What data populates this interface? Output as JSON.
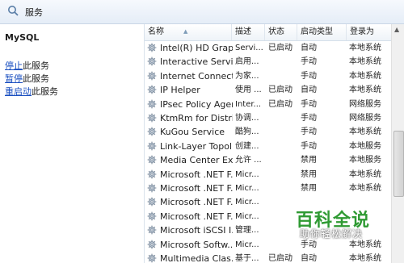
{
  "window": {
    "title": "服务"
  },
  "left_pane": {
    "service_name": "MySQL",
    "actions": [
      {
        "link": "停止",
        "suffix": "此服务"
      },
      {
        "link": "暂停",
        "suffix": "此服务"
      },
      {
        "link": "重启动",
        "suffix": "此服务"
      }
    ]
  },
  "table": {
    "columns": [
      "名称",
      "描述",
      "状态",
      "启动类型",
      "登录为"
    ],
    "sort_column": "名称",
    "rows": [
      {
        "name": "Intel(R) HD Grap...",
        "desc": "Servi...",
        "state": "已启动",
        "startup": "自动",
        "logon": "本地系统"
      },
      {
        "name": "Interactive Servi...",
        "desc": "启用...",
        "state": "",
        "startup": "手动",
        "logon": "本地系统"
      },
      {
        "name": "Internet Connect...",
        "desc": "为家...",
        "state": "",
        "startup": "手动",
        "logon": "本地系统"
      },
      {
        "name": "IP Helper",
        "desc": "使用 ...",
        "state": "已启动",
        "startup": "自动",
        "logon": "本地系统"
      },
      {
        "name": "IPsec Policy Agent",
        "desc": "Inter...",
        "state": "已启动",
        "startup": "手动",
        "logon": "网络服务"
      },
      {
        "name": "KtmRm for Distri...",
        "desc": "协调...",
        "state": "",
        "startup": "手动",
        "logon": "网络服务"
      },
      {
        "name": "KuGou Service",
        "desc": "酷狗...",
        "state": "",
        "startup": "手动",
        "logon": "本地系统"
      },
      {
        "name": "Link-Layer Topol...",
        "desc": "创建...",
        "state": "",
        "startup": "手动",
        "logon": "本地服务"
      },
      {
        "name": "Media Center Ex...",
        "desc": "允许 ...",
        "state": "",
        "startup": "禁用",
        "logon": "本地服务"
      },
      {
        "name": "Microsoft .NET F...",
        "desc": "Micr...",
        "state": "",
        "startup": "禁用",
        "logon": "本地系统"
      },
      {
        "name": "Microsoft .NET F...",
        "desc": "Micr...",
        "state": "",
        "startup": "禁用",
        "logon": "本地系统"
      },
      {
        "name": "Microsoft .NET F...",
        "desc": "Micr...",
        "state": "",
        "startup": "",
        "logon": ""
      },
      {
        "name": "Microsoft .NET F...",
        "desc": "Micr...",
        "state": "",
        "startup": "",
        "logon": ""
      },
      {
        "name": "Microsoft iSCSI I...",
        "desc": "管理...",
        "state": "",
        "startup": "",
        "logon": ""
      },
      {
        "name": "Microsoft Softw...",
        "desc": "Micr...",
        "state": "",
        "startup": "手动",
        "logon": "本地系统"
      },
      {
        "name": "Multimedia Clas...",
        "desc": "基于...",
        "state": "已启动",
        "startup": "自动",
        "logon": "本地系统"
      }
    ]
  },
  "watermark": {
    "title": "百科全说",
    "subtitle": "助你轻松解决"
  },
  "colors": {
    "link": "#1a4fc0",
    "watermark_green": "#2f9a33",
    "header_bg": "#e5edf7"
  }
}
